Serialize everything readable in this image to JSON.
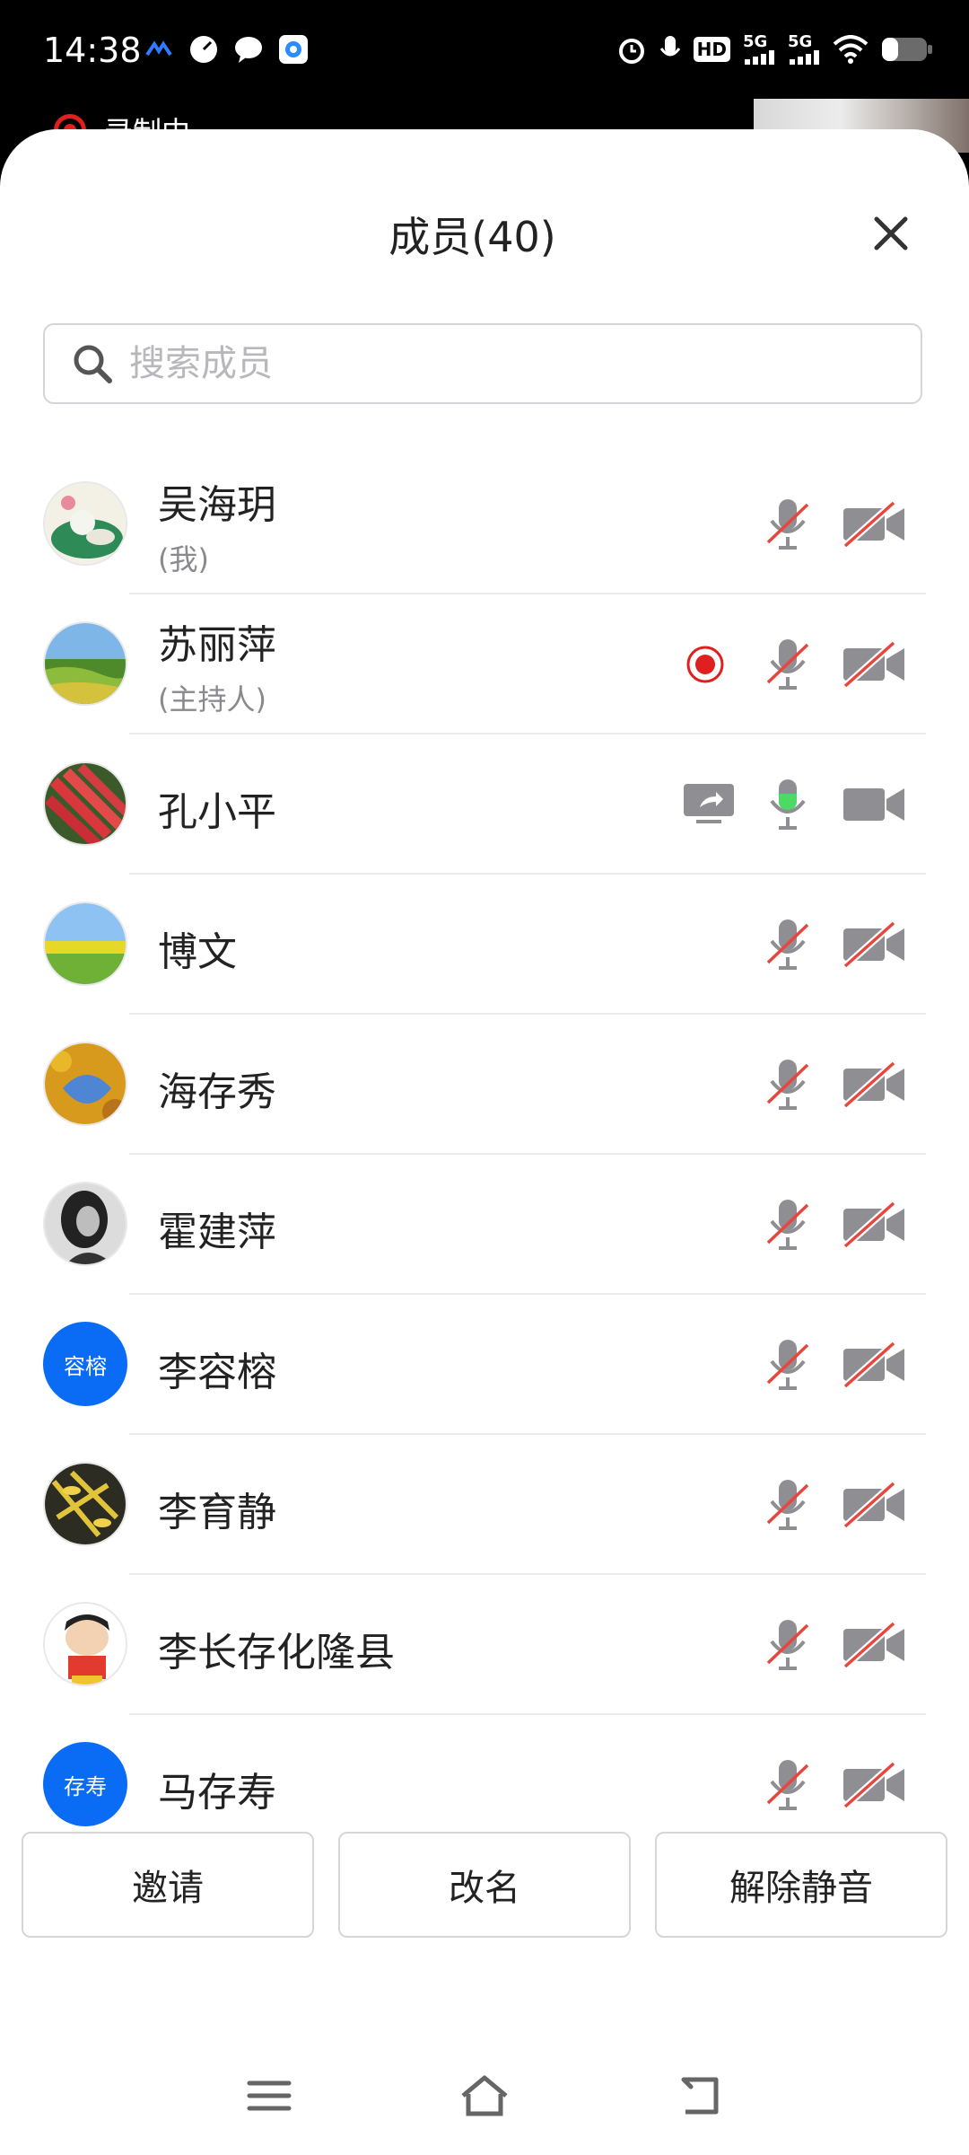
{
  "status_bar": {
    "time": "14:38",
    "network_1": "5G",
    "network_2": "5G",
    "hd_label": "HD"
  },
  "background": {
    "recording_label": "录制中"
  },
  "sheet": {
    "title": "成员(40)",
    "search_placeholder": "搜索成员"
  },
  "members": [
    {
      "name": "吴海玥",
      "role": "(我)",
      "avatar": "photo-lotus",
      "mic": "muted",
      "camera": "off"
    },
    {
      "name": "苏丽萍",
      "role": "(主持人)",
      "avatar": "photo-field",
      "mic": "muted",
      "camera": "off",
      "recording": true
    },
    {
      "name": "孔小平",
      "role": "",
      "avatar": "photo-carrots",
      "mic": "speaking",
      "camera": "on",
      "screen_sharing": true
    },
    {
      "name": "博文",
      "role": "",
      "avatar": "photo-grassland",
      "mic": "muted",
      "camera": "off"
    },
    {
      "name": "海存秀",
      "role": "",
      "avatar": "photo-autumn-leaves",
      "mic": "muted",
      "camera": "off"
    },
    {
      "name": "霍建萍",
      "role": "",
      "avatar": "photo-portrait-bw",
      "mic": "muted",
      "camera": "off"
    },
    {
      "name": "李容榕",
      "role": "",
      "avatar_text": "容榕",
      "mic": "muted",
      "camera": "off"
    },
    {
      "name": "李育静",
      "role": "",
      "avatar": "photo-yellow-branches",
      "mic": "muted",
      "camera": "off"
    },
    {
      "name": "李长存化隆县",
      "role": "",
      "avatar": "cartoon-boy",
      "mic": "muted",
      "camera": "off"
    },
    {
      "name": "马存寿",
      "role": "",
      "avatar_text": "存寿",
      "mic": "muted",
      "camera": "off"
    }
  ],
  "actions": {
    "invite": "邀请",
    "rename": "改名",
    "unmute": "解除静音"
  },
  "colors": {
    "accent": "#0a6cf5",
    "muted_slash": "#e8463c",
    "speaking": "#4cd964",
    "icon_gray": "#8e8e93",
    "recording": "#e02020"
  }
}
